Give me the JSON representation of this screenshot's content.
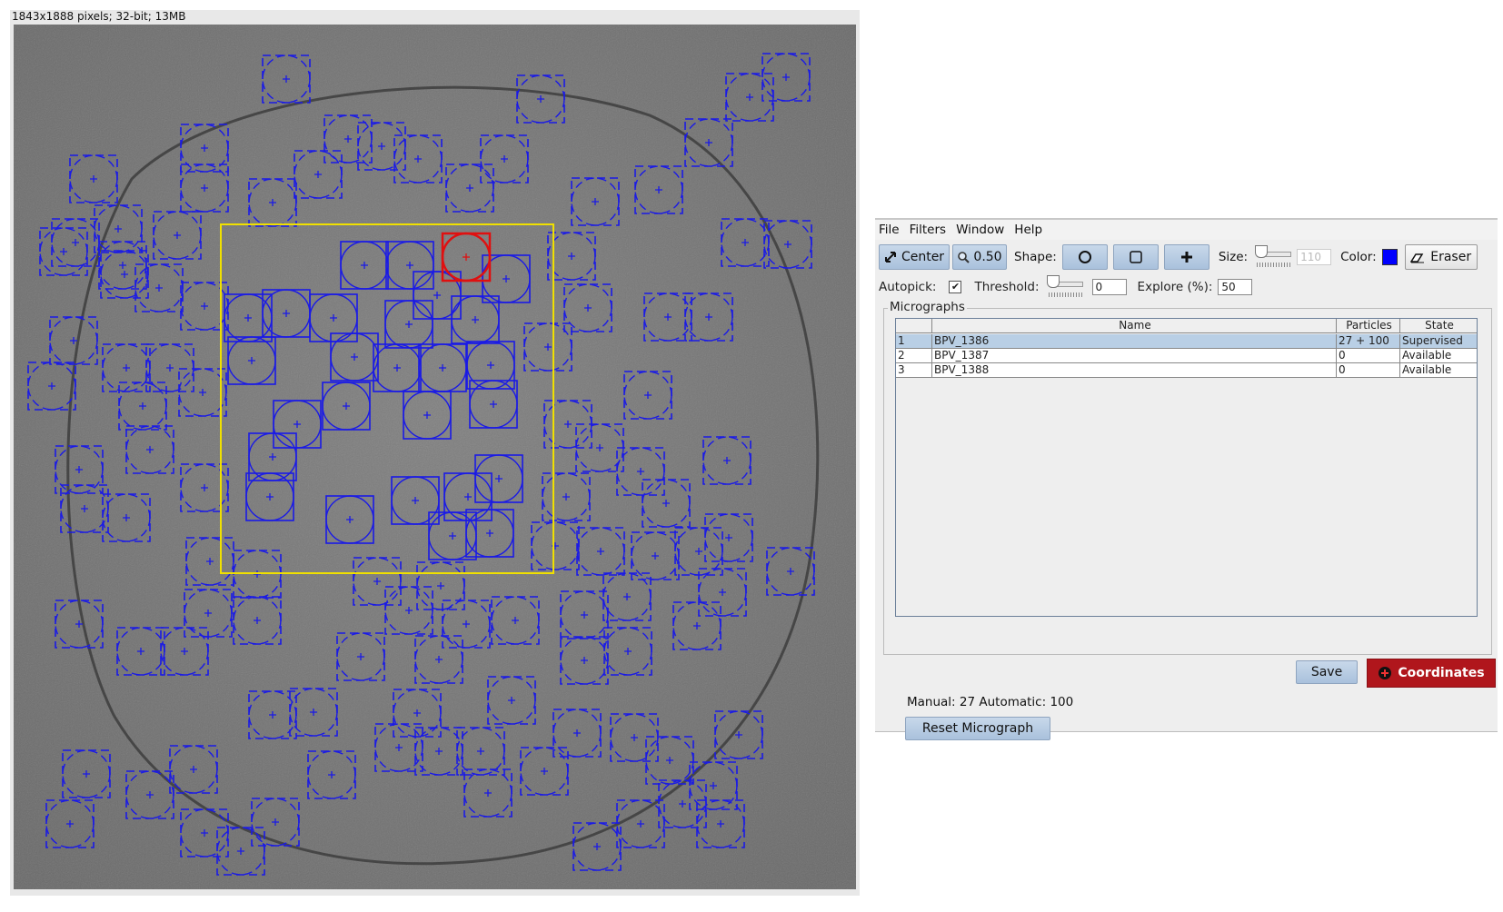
{
  "image_window": {
    "info": "1843x1888 pixels; 32-bit; 13MB"
  },
  "colors": {
    "particle": "#1a1ae6",
    "selected_particle": "#e01010",
    "selection_box": "#f0e000",
    "micrograph_background": "#7a7a7a",
    "coordinates_button": "#b0161c"
  },
  "picker": {
    "menu": [
      "File",
      "Filters",
      "Window",
      "Help"
    ],
    "toolbar": {
      "center_label": "Center",
      "center_icon": "crosshair-arrows-icon",
      "zoom_value": "0.50",
      "zoom_icon": "magnifier-icon",
      "shape_label": "Shape:",
      "shape_options": [
        "circle-icon",
        "square-icon",
        "plus-icon"
      ],
      "size_label": "Size:",
      "size_value": "110",
      "color_label": "Color:",
      "color_value": "#0000ff",
      "eraser_label": "Eraser",
      "eraser_icon": "eraser-icon"
    },
    "autopick": {
      "label": "Autopick:",
      "checked": true,
      "threshold_label": "Threshold:",
      "threshold_value": "0",
      "explore_label": "Explore (%):",
      "explore_value": "50"
    },
    "micrographs": {
      "title": "Micrographs",
      "columns": [
        "",
        "Name",
        "Particles",
        "State"
      ],
      "rows": [
        {
          "index": "1",
          "name": "BPV_1386",
          "particles": "27 + 100",
          "state": "Supervised"
        },
        {
          "index": "2",
          "name": "BPV_1387",
          "particles": "0",
          "state": "Available"
        },
        {
          "index": "3",
          "name": "BPV_1388",
          "particles": "0",
          "state": "Available"
        }
      ],
      "selected_row": 1
    },
    "counts": "Manual: 27 Automatic: 100",
    "reset_label": "Reset Micrograph",
    "save_label": "Save",
    "coordinates_label": "Coordinates"
  }
}
